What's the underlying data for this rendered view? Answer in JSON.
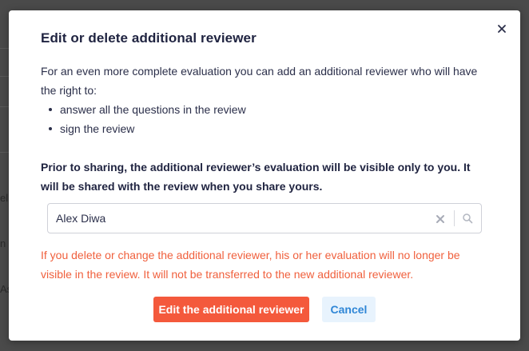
{
  "background": {
    "fragments": [
      "ell",
      "n",
      "As"
    ]
  },
  "modal": {
    "title": "Edit or delete additional reviewer",
    "close_icon": "close-icon",
    "intro": "For an even more complete evaluation you can add an additional reviewer who will have the right to:",
    "rights": [
      "answer all the questions in the review",
      "sign the review"
    ],
    "notice": "Prior to sharing, the additional reviewer’s evaluation will be visible only to you. It will be shared with the review when you share yours.",
    "reviewer_select": {
      "value": "Alex Diwa",
      "clear_icon": "clear-icon",
      "search_icon": "search-icon"
    },
    "warning": "If you delete or change the additional reviewer, his or her evaluation will no longer be visible in the review. It will not be transferred to the new additional reviewer.",
    "buttons": {
      "primary": "Edit the additional reviewer",
      "cancel": "Cancel"
    }
  },
  "colors": {
    "primary": "#f4593c",
    "warning_text": "#f0603d",
    "cancel_text": "#2f86d6",
    "cancel_bg": "#e8f3fd",
    "heading": "#1f2340"
  }
}
